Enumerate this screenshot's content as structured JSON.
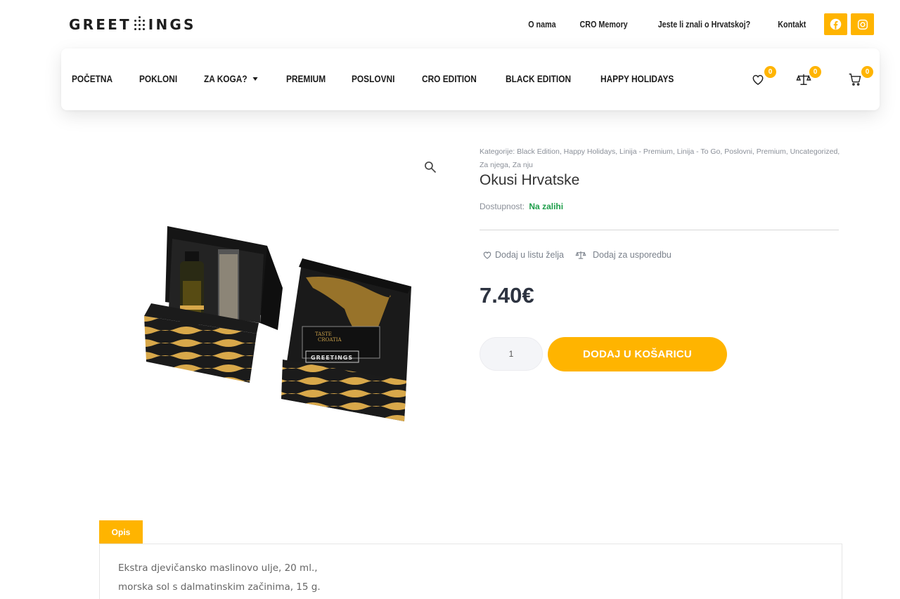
{
  "brand": {
    "logo_left": "GREET",
    "logo_right": "INGS"
  },
  "top_links": [
    "O nama",
    "CRO Memory",
    "Jeste li znali o Hrvatskoj?",
    "Kontakt"
  ],
  "social": {
    "facebook": "facebook-icon",
    "instagram": "instagram-icon"
  },
  "menu": [
    {
      "label": "POČETNA",
      "dropdown": false
    },
    {
      "label": "POKLONI",
      "dropdown": false
    },
    {
      "label": "ZA KOGA?",
      "dropdown": true
    },
    {
      "label": "PREMIUM",
      "dropdown": false
    },
    {
      "label": "POSLOVNI",
      "dropdown": false
    },
    {
      "label": "CRO EDITION",
      "dropdown": false
    },
    {
      "label": "BLACK EDITION",
      "dropdown": false
    },
    {
      "label": "HAPPY HOLIDAYS",
      "dropdown": false
    }
  ],
  "counters": {
    "wishlist": "0",
    "compare": "0",
    "cart": "0"
  },
  "product": {
    "categories_label": "Kategorije:",
    "categories": "Black Edition, Happy Holidays, Linija - Premium, Linija - To Go, Poslovni, Premium, Uncategorized, Za njega, Za nju",
    "title": "Okusi Hrvatske",
    "stock_label": "Dostupnost:",
    "stock_value": "Na zalihi",
    "wishlist_label": "Dodaj u listu želja",
    "compare_label": "Dodaj za usporedbu",
    "price": "7.40€",
    "quantity": "1",
    "add_to_cart": "DODAJ U KOŠARICU",
    "box_label": "GREETINGS"
  },
  "tabs": {
    "description": "Opis"
  },
  "description": [
    "Ekstra djevičansko maslinovo ulje, 20 ml.,",
    "morska sol s dalmatinskim začinima, 15 g."
  ],
  "colors": {
    "accent": "#ffb400",
    "stock": "#1e9e4a",
    "price": "#2d3340"
  }
}
